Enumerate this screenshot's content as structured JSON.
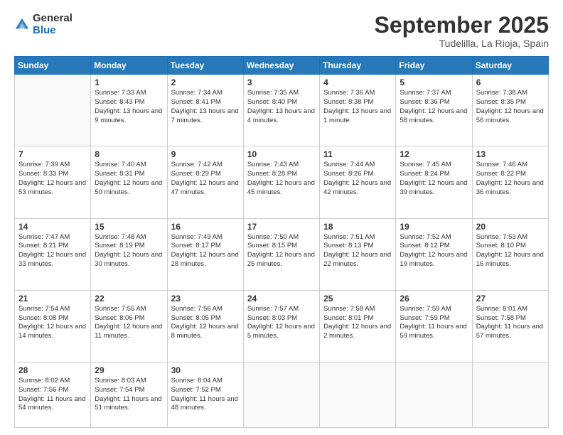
{
  "logo": {
    "general": "General",
    "blue": "Blue"
  },
  "header": {
    "month": "September 2025",
    "location": "Tudelilla, La Rioja, Spain"
  },
  "days_of_week": [
    "Sunday",
    "Monday",
    "Tuesday",
    "Wednesday",
    "Thursday",
    "Friday",
    "Saturday"
  ],
  "weeks": [
    [
      {
        "day": "",
        "sunrise": "",
        "sunset": "",
        "daylight": ""
      },
      {
        "day": "1",
        "sunrise": "Sunrise: 7:33 AM",
        "sunset": "Sunset: 8:43 PM",
        "daylight": "Daylight: 13 hours and 9 minutes."
      },
      {
        "day": "2",
        "sunrise": "Sunrise: 7:34 AM",
        "sunset": "Sunset: 8:41 PM",
        "daylight": "Daylight: 13 hours and 7 minutes."
      },
      {
        "day": "3",
        "sunrise": "Sunrise: 7:35 AM",
        "sunset": "Sunset: 8:40 PM",
        "daylight": "Daylight: 13 hours and 4 minutes."
      },
      {
        "day": "4",
        "sunrise": "Sunrise: 7:36 AM",
        "sunset": "Sunset: 8:38 PM",
        "daylight": "Daylight: 13 hours and 1 minute."
      },
      {
        "day": "5",
        "sunrise": "Sunrise: 7:37 AM",
        "sunset": "Sunset: 8:36 PM",
        "daylight": "Daylight: 12 hours and 58 minutes."
      },
      {
        "day": "6",
        "sunrise": "Sunrise: 7:38 AM",
        "sunset": "Sunset: 8:35 PM",
        "daylight": "Daylight: 12 hours and 56 minutes."
      }
    ],
    [
      {
        "day": "7",
        "sunrise": "Sunrise: 7:39 AM",
        "sunset": "Sunset: 8:33 PM",
        "daylight": "Daylight: 12 hours and 53 minutes."
      },
      {
        "day": "8",
        "sunrise": "Sunrise: 7:40 AM",
        "sunset": "Sunset: 8:31 PM",
        "daylight": "Daylight: 12 hours and 50 minutes."
      },
      {
        "day": "9",
        "sunrise": "Sunrise: 7:42 AM",
        "sunset": "Sunset: 8:29 PM",
        "daylight": "Daylight: 12 hours and 47 minutes."
      },
      {
        "day": "10",
        "sunrise": "Sunrise: 7:43 AM",
        "sunset": "Sunset: 8:28 PM",
        "daylight": "Daylight: 12 hours and 45 minutes."
      },
      {
        "day": "11",
        "sunrise": "Sunrise: 7:44 AM",
        "sunset": "Sunset: 8:26 PM",
        "daylight": "Daylight: 12 hours and 42 minutes."
      },
      {
        "day": "12",
        "sunrise": "Sunrise: 7:45 AM",
        "sunset": "Sunset: 8:24 PM",
        "daylight": "Daylight: 12 hours and 39 minutes."
      },
      {
        "day": "13",
        "sunrise": "Sunrise: 7:46 AM",
        "sunset": "Sunset: 8:22 PM",
        "daylight": "Daylight: 12 hours and 36 minutes."
      }
    ],
    [
      {
        "day": "14",
        "sunrise": "Sunrise: 7:47 AM",
        "sunset": "Sunset: 8:21 PM",
        "daylight": "Daylight: 12 hours and 33 minutes."
      },
      {
        "day": "15",
        "sunrise": "Sunrise: 7:48 AM",
        "sunset": "Sunset: 8:19 PM",
        "daylight": "Daylight: 12 hours and 30 minutes."
      },
      {
        "day": "16",
        "sunrise": "Sunrise: 7:49 AM",
        "sunset": "Sunset: 8:17 PM",
        "daylight": "Daylight: 12 hours and 28 minutes."
      },
      {
        "day": "17",
        "sunrise": "Sunrise: 7:50 AM",
        "sunset": "Sunset: 8:15 PM",
        "daylight": "Daylight: 12 hours and 25 minutes."
      },
      {
        "day": "18",
        "sunrise": "Sunrise: 7:51 AM",
        "sunset": "Sunset: 8:13 PM",
        "daylight": "Daylight: 12 hours and 22 minutes."
      },
      {
        "day": "19",
        "sunrise": "Sunrise: 7:52 AM",
        "sunset": "Sunset: 8:12 PM",
        "daylight": "Daylight: 12 hours and 19 minutes."
      },
      {
        "day": "20",
        "sunrise": "Sunrise: 7:53 AM",
        "sunset": "Sunset: 8:10 PM",
        "daylight": "Daylight: 12 hours and 16 minutes."
      }
    ],
    [
      {
        "day": "21",
        "sunrise": "Sunrise: 7:54 AM",
        "sunset": "Sunset: 8:08 PM",
        "daylight": "Daylight: 12 hours and 14 minutes."
      },
      {
        "day": "22",
        "sunrise": "Sunrise: 7:55 AM",
        "sunset": "Sunset: 8:06 PM",
        "daylight": "Daylight: 12 hours and 11 minutes."
      },
      {
        "day": "23",
        "sunrise": "Sunrise: 7:56 AM",
        "sunset": "Sunset: 8:05 PM",
        "daylight": "Daylight: 12 hours and 8 minutes."
      },
      {
        "day": "24",
        "sunrise": "Sunrise: 7:57 AM",
        "sunset": "Sunset: 8:03 PM",
        "daylight": "Daylight: 12 hours and 5 minutes."
      },
      {
        "day": "25",
        "sunrise": "Sunrise: 7:58 AM",
        "sunset": "Sunset: 8:01 PM",
        "daylight": "Daylight: 12 hours and 2 minutes."
      },
      {
        "day": "26",
        "sunrise": "Sunrise: 7:59 AM",
        "sunset": "Sunset: 7:59 PM",
        "daylight": "Daylight: 11 hours and 59 minutes."
      },
      {
        "day": "27",
        "sunrise": "Sunrise: 8:01 AM",
        "sunset": "Sunset: 7:58 PM",
        "daylight": "Daylight: 11 hours and 57 minutes."
      }
    ],
    [
      {
        "day": "28",
        "sunrise": "Sunrise: 8:02 AM",
        "sunset": "Sunset: 7:56 PM",
        "daylight": "Daylight: 11 hours and 54 minutes."
      },
      {
        "day": "29",
        "sunrise": "Sunrise: 8:03 AM",
        "sunset": "Sunset: 7:54 PM",
        "daylight": "Daylight: 11 hours and 51 minutes."
      },
      {
        "day": "30",
        "sunrise": "Sunrise: 8:04 AM",
        "sunset": "Sunset: 7:52 PM",
        "daylight": "Daylight: 11 hours and 48 minutes."
      },
      {
        "day": "",
        "sunrise": "",
        "sunset": "",
        "daylight": ""
      },
      {
        "day": "",
        "sunrise": "",
        "sunset": "",
        "daylight": ""
      },
      {
        "day": "",
        "sunrise": "",
        "sunset": "",
        "daylight": ""
      },
      {
        "day": "",
        "sunrise": "",
        "sunset": "",
        "daylight": ""
      }
    ]
  ]
}
